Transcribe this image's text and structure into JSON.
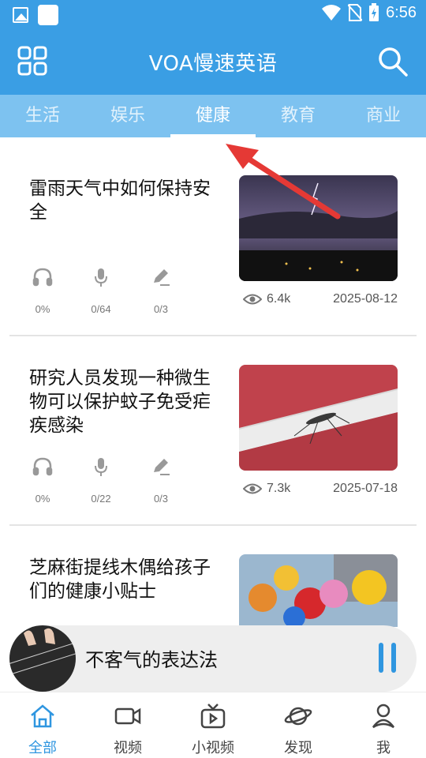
{
  "status_bar": {
    "time": "6:56"
  },
  "app_bar": {
    "title": "VOA慢速英语",
    "menu_icon": "grid-icon",
    "search_icon": "search-icon"
  },
  "tabs": [
    {
      "label": "生活",
      "active": false
    },
    {
      "label": "娱乐",
      "active": false
    },
    {
      "label": "健康",
      "active": true
    },
    {
      "label": "教育",
      "active": false
    },
    {
      "label": "商业",
      "active": false
    }
  ],
  "articles": [
    {
      "title": "雷雨天气中如何保持安全",
      "listen": "0%",
      "speak": "0/64",
      "write": "0/3",
      "views": "6.4k",
      "date": "2025-08-12"
    },
    {
      "title": "研究人员发现一种微生物可以保护蚊子免受疟疾感染",
      "listen": "0%",
      "speak": "0/22",
      "write": "0/3",
      "views": "7.3k",
      "date": "2025-07-18"
    },
    {
      "title": "芝麻街提线木偶给孩子们的健康小贴士"
    }
  ],
  "player": {
    "title": "不客气的表达法"
  },
  "bottom_nav": [
    {
      "label": "全部",
      "icon": "home-icon",
      "active": true
    },
    {
      "label": "视频",
      "icon": "video-icon",
      "active": false
    },
    {
      "label": "小视频",
      "icon": "tv-icon",
      "active": false
    },
    {
      "label": "发现",
      "icon": "planet-icon",
      "active": false
    },
    {
      "label": "我",
      "icon": "user-icon",
      "active": false
    }
  ],
  "colors": {
    "primary": "#3a9ee4",
    "tab_bar": "#7dc2f0",
    "accent": "#2f96e0",
    "annotation_arrow": "#e53935"
  }
}
